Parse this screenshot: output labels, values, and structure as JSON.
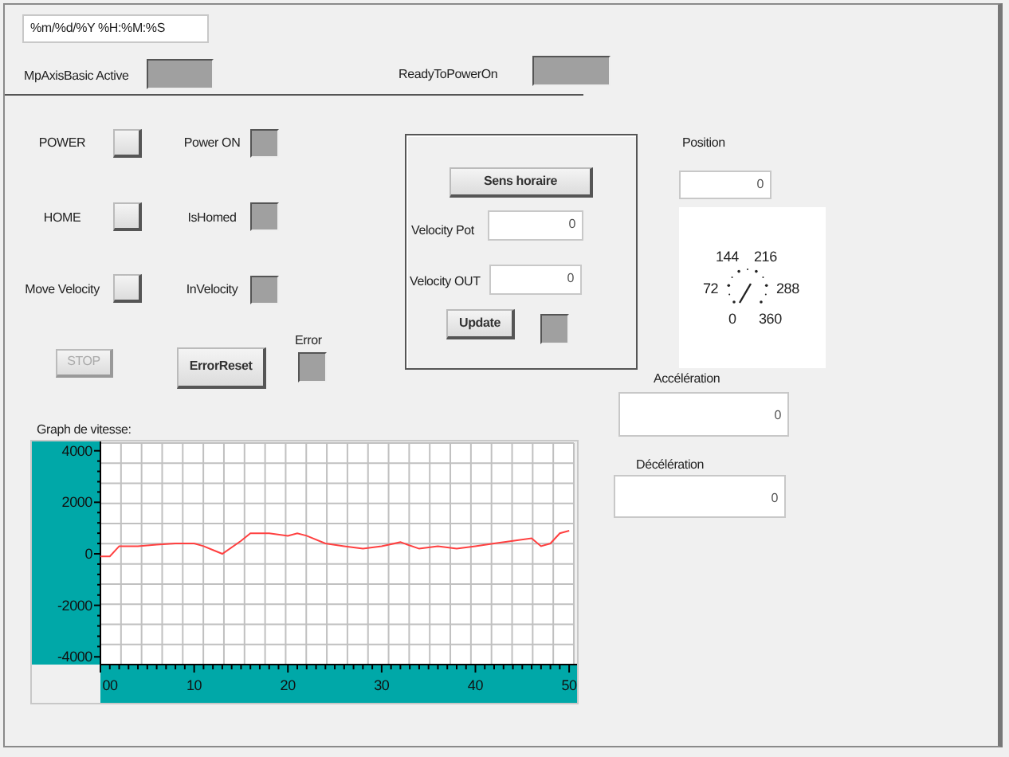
{
  "header": {
    "datetime_field": {
      "value": "%m/%d/%Y %H:%M:%S"
    },
    "indicators": [
      {
        "label": "MpAxisBasic Active",
        "on": false
      },
      {
        "label": "ReadyToPowerOn",
        "on": false
      }
    ]
  },
  "controls": [
    {
      "label": "POWER",
      "indicator": {
        "label": "Power ON",
        "on": false
      }
    },
    {
      "label": "HOME",
      "indicator": {
        "label": "IsHomed",
        "on": false
      }
    },
    {
      "label": "Move Velocity",
      "indicator": {
        "label": "InVelocity",
        "on": false
      }
    }
  ],
  "stop_button": {
    "label": "STOP",
    "disabled": true
  },
  "error_reset_button": {
    "label": "ErrorReset"
  },
  "error_indicator": {
    "label": "Error",
    "on": false
  },
  "direction_group": {
    "button": "Sens horaire",
    "fields": [
      {
        "label": "Velocity Pot",
        "value": "0"
      },
      {
        "label": "Velocity OUT",
        "value": "0"
      }
    ],
    "update_button": "Update",
    "indicator": {
      "on": false
    }
  },
  "position": {
    "label": "Position",
    "value": "0",
    "gauge_labels": [
      "144",
      "216",
      "72",
      "288",
      "0",
      "360"
    ]
  },
  "acceleration": {
    "label": "Accélération",
    "value": "0"
  },
  "deceleration": {
    "label": "Décélération",
    "value": "0"
  },
  "speed_graph": {
    "label": "Graph de vitesse:",
    "chart_data": {
      "type": "line",
      "x": [
        0,
        1,
        2,
        4,
        6,
        8,
        10,
        11,
        12,
        13,
        15,
        16,
        18,
        20,
        21,
        22,
        24,
        26,
        28,
        30,
        32,
        34,
        36,
        38,
        40,
        42,
        44,
        46,
        47,
        48,
        49,
        50
      ],
      "series": [
        {
          "color": "#ff4040",
          "values": [
            -100,
            -100,
            300,
            300,
            350,
            400,
            400,
            300,
            150,
            0,
            500,
            800,
            800,
            700,
            800,
            700,
            400,
            300,
            200,
            300,
            450,
            200,
            300,
            200,
            300,
            400,
            500,
            600,
            300,
            400,
            800,
            900
          ]
        }
      ],
      "grid": true,
      "xlim": [
        0,
        50.5
      ],
      "ylim": [
        -4300,
        4300
      ],
      "xticks": [
        {
          "value": 0,
          "label": "00"
        },
        10,
        20,
        30,
        40,
        50
      ],
      "yticks": [
        -4000,
        -2000,
        0,
        2000,
        4000
      ]
    }
  }
}
